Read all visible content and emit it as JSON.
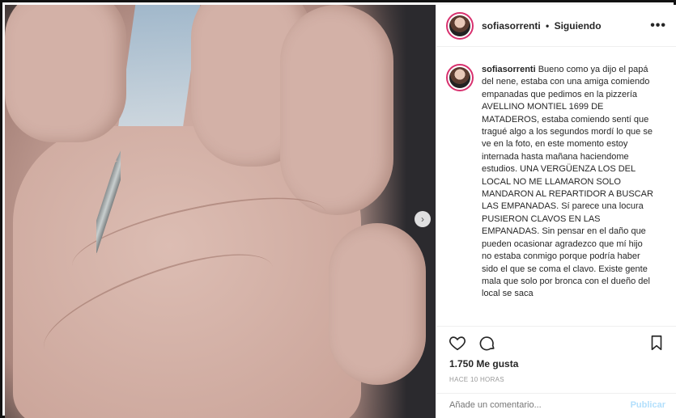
{
  "post": {
    "username": "sofiasorrenti",
    "separator": "•",
    "follow_status": "Siguiendo",
    "more": "•••",
    "caption_text": "Bueno como ya dijo el papá del nene, estaba con una amiga comiendo empanadas que pedimos en la pizzería AVELLINO MONTIEL 1699 DE MATADEROS, estaba comiendo sentí que tragué algo a los segundos mordí lo que se ve en la foto, en este momento estoy internada hasta mañana haciendome estudios. UNA VERGÜENZA LOS DEL LOCAL NO ME LLAMARON SOLO MANDARON AL REPARTIDOR A BUSCAR LAS EMPANADAS. Sí parece una locura PUSIERON CLAVOS EN LAS EMPANADAS. Sin pensar en el daño que pueden ocasionar agradezco que mí hijo no estaba conmigo porque podría haber sido el que se coma el clavo. Existe gente mala que solo por bronca con el dueño del local se saca",
    "likes": "1.750 Me gusta",
    "time": "HACE 10 HORAS"
  },
  "icons": {
    "like": "heart-icon",
    "comment": "comment-icon",
    "save": "bookmark-icon",
    "next": "chevron-right-icon"
  },
  "comment": {
    "placeholder": "Añade un comentario...",
    "publish_label": "Publicar"
  },
  "colors": {
    "story_ring": "#d8316f",
    "publish_disabled": "#b2dffc"
  }
}
